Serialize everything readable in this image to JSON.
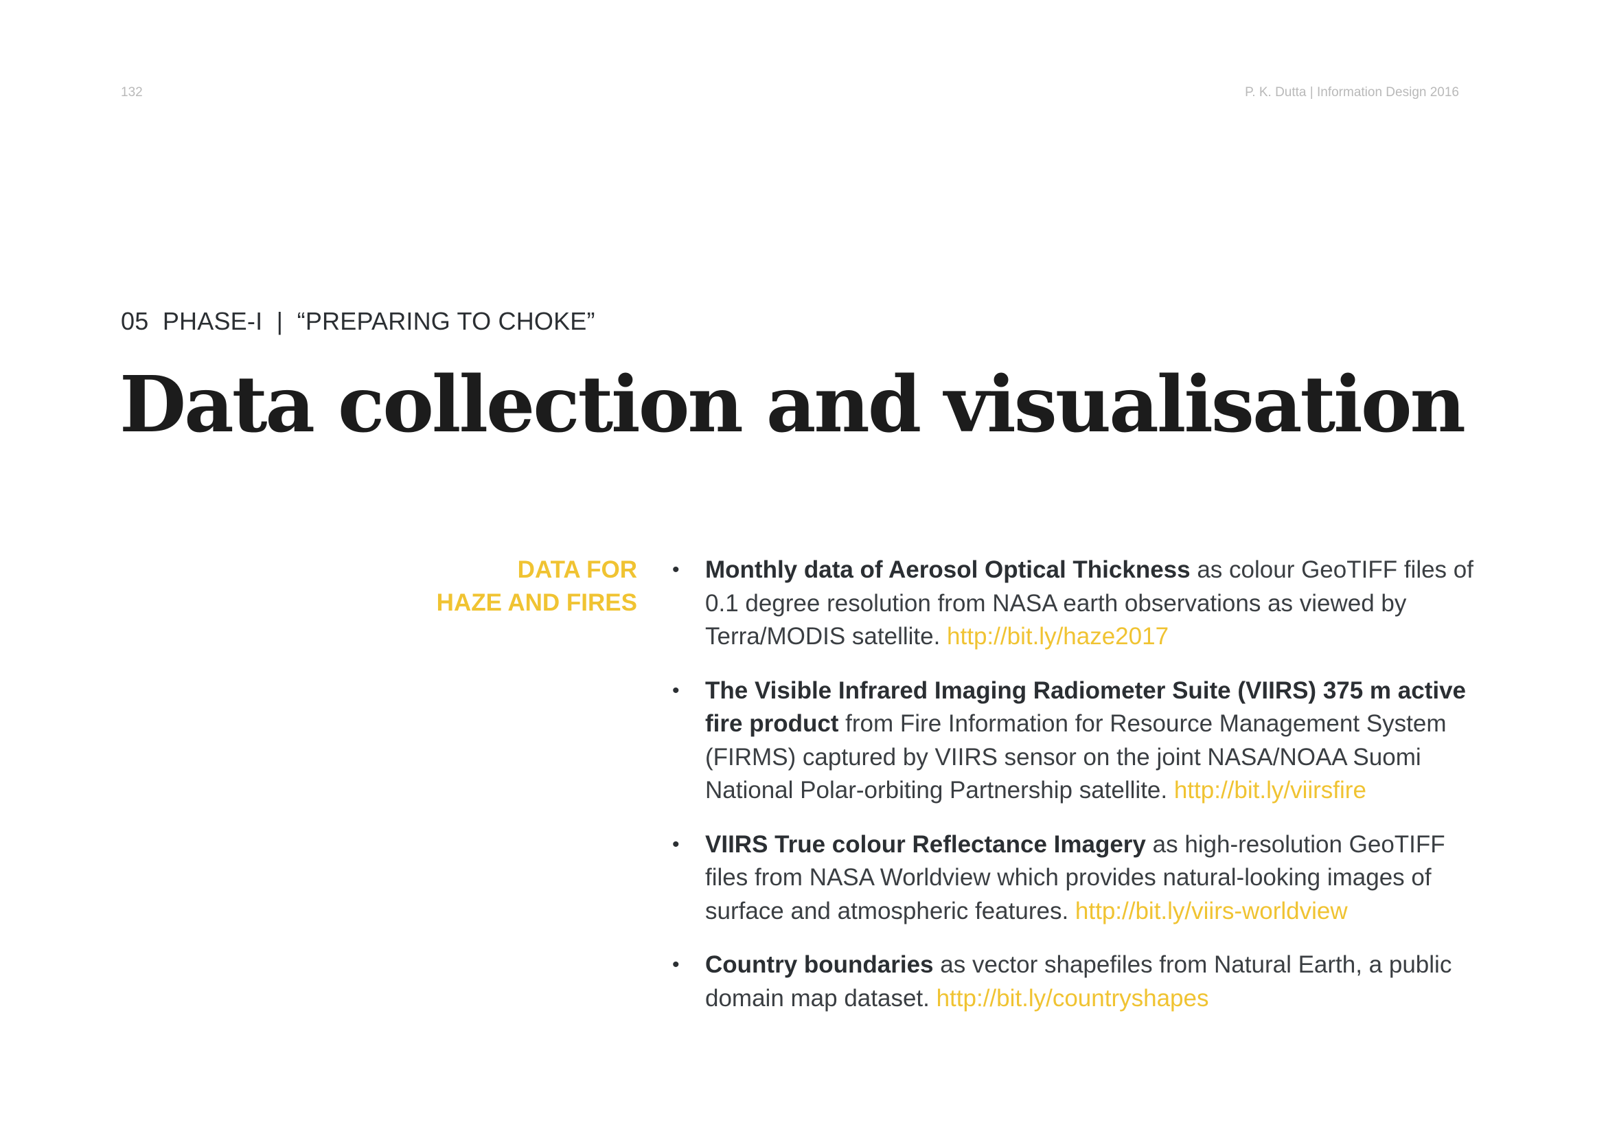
{
  "header": {
    "page_number": "132",
    "running_head": "P. K. Dutta | Information Design 2016"
  },
  "section": {
    "label": "05  PHASE-I  |  “PREPARING TO CHOKE”",
    "title": "Data collection and visualisation"
  },
  "side_heading": {
    "line1": "DATA FOR",
    "line2": "HAZE AND FIRES"
  },
  "sources": [
    {
      "bold": "Monthly data of Aerosol Optical Thickness",
      "text": " as colour GeoTIFF files of 0.1 degree resolution from NASA earth observations as viewed by Terra/MODIS satellite. ",
      "link": "http://bit.ly/haze2017"
    },
    {
      "bold": "The Visible Infrared Imaging Radiometer Suite (VIIRS) 375 m active fire product",
      "text": " from Fire Information for Resource Management System (FIRMS) captured by VIIRS sensor on the joint NASA/NOAA Suomi National Polar-orbiting Partnership satellite. ",
      "link": "http://bit.ly/viirsfire"
    },
    {
      "bold": "VIIRS True colour Reflectance Imagery",
      "text": " as high-resolution GeoTIFF files from NASA Worldview which provides natural-looking images of surface and atmospheric features. ",
      "link": "http://bit.ly/viirs-worldview"
    },
    {
      "bold": "Country boundaries",
      "text": " as vector shapefiles from Natural Earth, a public domain map dataset. ",
      "link": "http://bit.ly/countryshapes"
    }
  ],
  "bullet_symbol": "•",
  "colors": {
    "accent": "#f0c332",
    "title": "#1c1c1c",
    "body": "#33373b",
    "muted": "#b9b9b9"
  }
}
